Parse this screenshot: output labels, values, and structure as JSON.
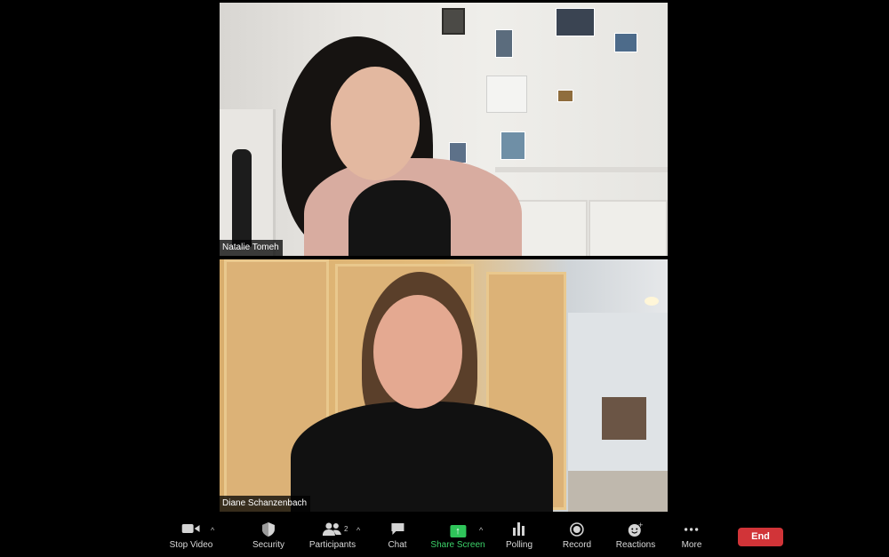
{
  "participants": [
    {
      "name": "Natalie Tomeh"
    },
    {
      "name": "Diane Schanzenbach"
    }
  ],
  "toolbar": {
    "stop_video": "Stop Video",
    "security": "Security",
    "participants": "Participants",
    "participants_count": "2",
    "chat": "Chat",
    "share_screen": "Share Screen",
    "polling": "Polling",
    "record": "Record",
    "reactions": "Reactions",
    "more": "More",
    "end": "End"
  },
  "colors": {
    "share_accent": "#2fc55a",
    "end_button": "#d13438"
  }
}
